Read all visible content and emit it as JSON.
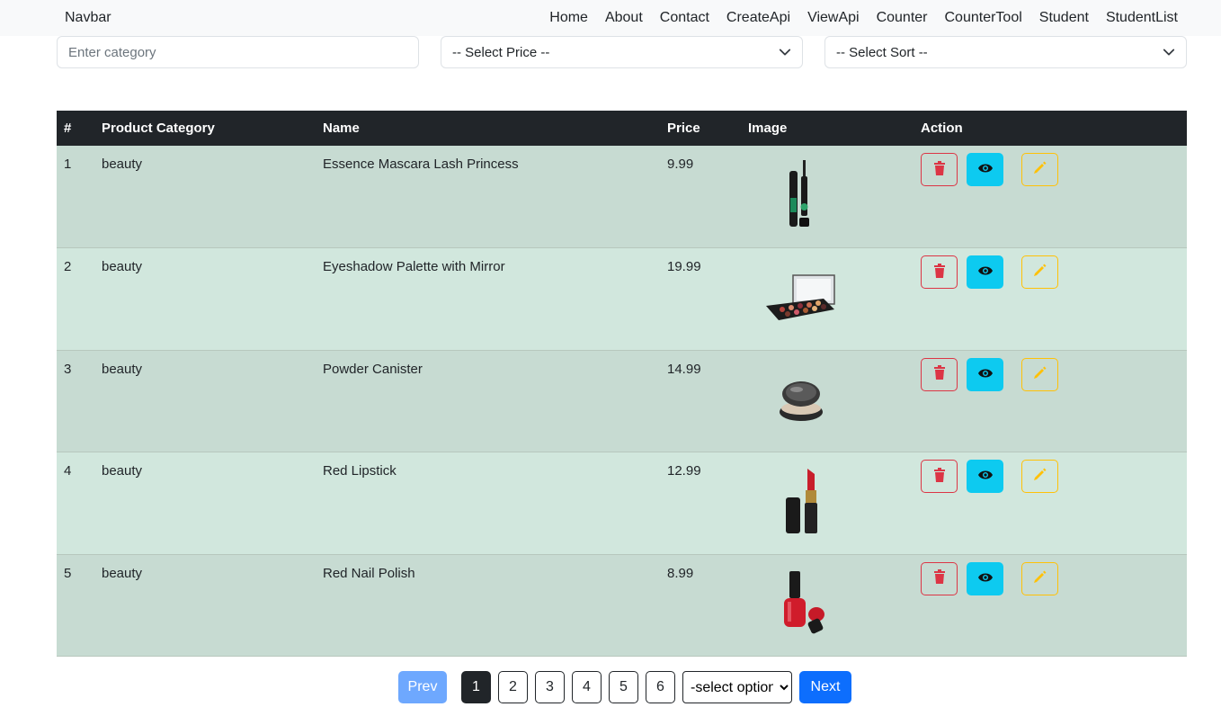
{
  "navbar": {
    "brand": "Navbar",
    "links": [
      "Home",
      "About",
      "Contact",
      "CreateApi",
      "ViewApi",
      "Counter",
      "CounterTool",
      "Student",
      "StudentList"
    ]
  },
  "filters": {
    "category_placeholder": "Enter category",
    "price_select": "-- Select Price --",
    "sort_select": "-- Select Sort --"
  },
  "table": {
    "headers": [
      "#",
      "Product Category",
      "Name",
      "Price",
      "Image",
      "Action"
    ],
    "rows": [
      {
        "index": "1",
        "category": "beauty",
        "name": "Essence Mascara Lash Princess",
        "price": "9.99",
        "image": "mascara"
      },
      {
        "index": "2",
        "category": "beauty",
        "name": "Eyeshadow Palette with Mirror",
        "price": "19.99",
        "image": "eyeshadow-palette"
      },
      {
        "index": "3",
        "category": "beauty",
        "name": "Powder Canister",
        "price": "14.99",
        "image": "powder-canister"
      },
      {
        "index": "4",
        "category": "beauty",
        "name": "Red Lipstick",
        "price": "12.99",
        "image": "lipstick"
      },
      {
        "index": "5",
        "category": "beauty",
        "name": "Red Nail Polish",
        "price": "8.99",
        "image": "nail-polish"
      }
    ]
  },
  "pagination": {
    "prev": "Prev",
    "pages": [
      "1",
      "2",
      "3",
      "4",
      "5",
      "6"
    ],
    "active_page": "1",
    "select_option": "-select option-",
    "next": "Next"
  },
  "colors": {
    "delete": "#dc3545",
    "view": "#0dcaf0",
    "edit": "#ffc107",
    "header_bg": "#212529",
    "row_odd": "#c7dbd2",
    "row_even": "#d1e7dd",
    "primary": "#0d6efd"
  }
}
